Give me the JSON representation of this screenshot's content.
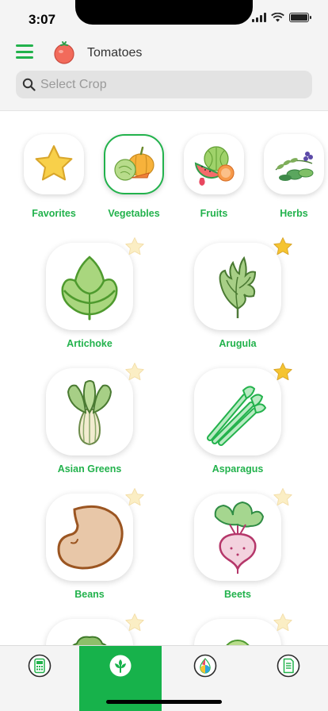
{
  "status_bar": {
    "time": "3:07"
  },
  "header": {
    "crop_name": "Tomatoes",
    "search_placeholder": "Select Crop"
  },
  "categories": [
    {
      "label": "Favorites",
      "icon": "star-icon"
    },
    {
      "label": "Vegetables",
      "icon": "vegetables-icon",
      "selected": true
    },
    {
      "label": "Fruits",
      "icon": "fruits-icon"
    },
    {
      "label": "Herbs",
      "icon": "herbs-icon"
    }
  ],
  "crops": [
    {
      "label": "Artichoke",
      "icon": "artichoke-icon",
      "favorite": false
    },
    {
      "label": "Arugula",
      "icon": "arugula-icon",
      "favorite": true
    },
    {
      "label": "Asian Greens",
      "icon": "asian-greens-icon",
      "favorite": false
    },
    {
      "label": "Asparagus",
      "icon": "asparagus-icon",
      "favorite": true
    },
    {
      "label": "Beans",
      "icon": "beans-icon",
      "favorite": false
    },
    {
      "label": "Beets",
      "icon": "beets-icon",
      "favorite": false
    },
    {
      "label": "",
      "icon": "broccoli-icon",
      "favorite": false
    },
    {
      "label": "",
      "icon": "cabbage-icon",
      "favorite": false
    }
  ],
  "tabbar": {
    "tabs": [
      {
        "name": "calculator-icon"
      },
      {
        "name": "leaf-icon",
        "active": true
      },
      {
        "name": "drop-icon"
      },
      {
        "name": "document-icon"
      }
    ]
  },
  "colors": {
    "accent": "#22b24c",
    "star_active": "#f5c431",
    "star_inactive": "#fbeec4"
  }
}
